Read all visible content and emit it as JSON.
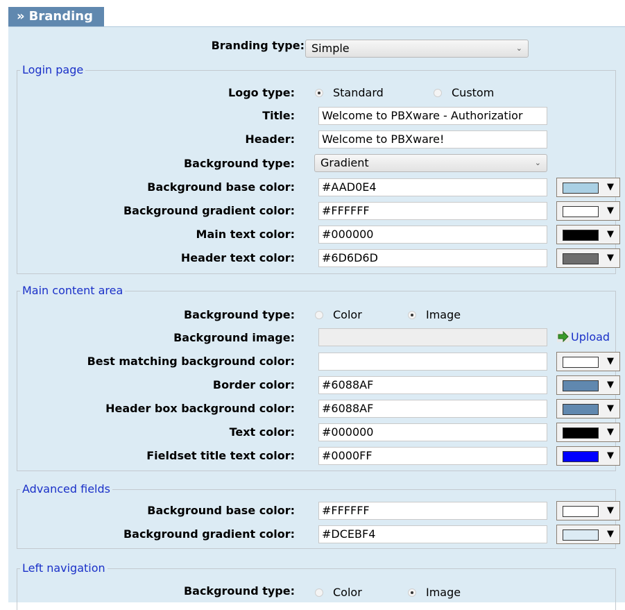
{
  "tab": {
    "title": "Branding",
    "prefix": "»"
  },
  "branding_type": {
    "label": "Branding type:",
    "value": "Simple"
  },
  "login_page": {
    "legend": "Login page",
    "logo_type": {
      "label": "Logo type:",
      "opt1": "Standard",
      "opt2": "Custom",
      "selected": "Standard"
    },
    "title": {
      "label": "Title:",
      "value": "Welcome to PBXware - Authorizatior"
    },
    "header": {
      "label": "Header:",
      "value": "Welcome to PBXware!"
    },
    "bg_type": {
      "label": "Background type:",
      "value": "Gradient"
    },
    "bg_base": {
      "label": "Background base color:",
      "value": "#AAD0E4",
      "swatch": "#AAD0E4"
    },
    "bg_gradient": {
      "label": "Background gradient color:",
      "value": "#FFFFFF",
      "swatch": "#FFFFFF"
    },
    "main_text": {
      "label": "Main text color:",
      "value": "#000000",
      "swatch": "#000000"
    },
    "header_text": {
      "label": "Header text color:",
      "value": "#6D6D6D",
      "swatch": "#6D6D6D"
    }
  },
  "main_content": {
    "legend": "Main content area",
    "bg_type": {
      "label": "Background type:",
      "opt1": "Color",
      "opt2": "Image",
      "selected": "Image"
    },
    "bg_image": {
      "label": "Background image:",
      "value": "",
      "upload": "Upload"
    },
    "best_bg": {
      "label": "Best matching background color:",
      "value": "",
      "swatch": "#FFFFFF"
    },
    "border": {
      "label": "Border color:",
      "value": "#6088AF",
      "swatch": "#6088AF"
    },
    "header_box": {
      "label": "Header box background color:",
      "value": "#6088AF",
      "swatch": "#6088AF"
    },
    "text": {
      "label": "Text color:",
      "value": "#000000",
      "swatch": "#000000"
    },
    "fieldset_title": {
      "label": "Fieldset title text color:",
      "value": "#0000FF",
      "swatch": "#0000FF"
    }
  },
  "advanced": {
    "legend": "Advanced fields",
    "bg_base": {
      "label": "Background base color:",
      "value": "#FFFFFF",
      "swatch": "#FFFFFF"
    },
    "bg_gradient": {
      "label": "Background gradient color:",
      "value": "#DCEBF4",
      "swatch": "#DCEBF4"
    }
  },
  "left_nav": {
    "legend": "Left navigation",
    "bg_type": {
      "label": "Background type:",
      "opt1": "Color",
      "opt2": "Image",
      "selected": "Image"
    }
  },
  "colors": {
    "tab_bg": "#6088AF",
    "panel_bg": "#DCEBF4",
    "legend": "#1a30c8"
  },
  "icons": {
    "dropdown": "chevron-down-icon",
    "picker": "triangle-down-icon",
    "upload": "upload-arrow-icon"
  }
}
